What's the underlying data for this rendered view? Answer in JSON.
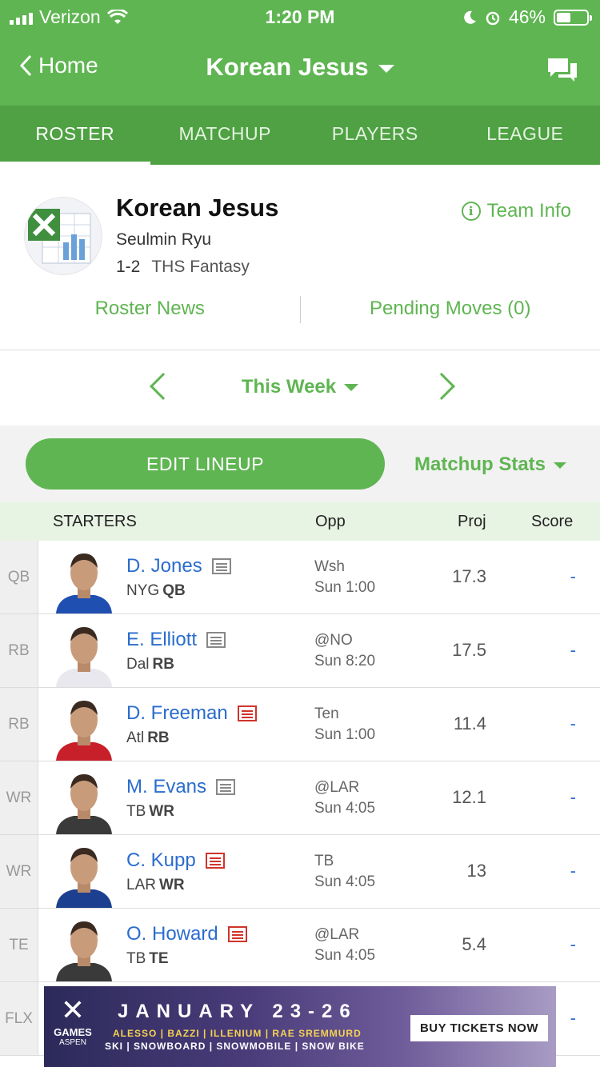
{
  "status": {
    "carrier": "Verizon",
    "time": "1:20 PM",
    "battery": "46%",
    "battery_level": 0.46
  },
  "header": {
    "back_label": "Home",
    "title": "Korean Jesus"
  },
  "tabs": [
    {
      "label": "ROSTER",
      "active": true
    },
    {
      "label": "MATCHUP",
      "active": false
    },
    {
      "label": "PLAYERS",
      "active": false
    },
    {
      "label": "LEAGUE",
      "active": false
    }
  ],
  "team": {
    "name": "Korean Jesus",
    "owner": "Seulmin Ryu",
    "record": "1-2",
    "league": "THS Fantasy",
    "info_label": "Team Info",
    "roster_news": "Roster News",
    "pending_moves": "Pending Moves (0)"
  },
  "week": {
    "label": "This Week"
  },
  "actions": {
    "edit_lineup": "EDIT LINEUP",
    "matchup_stats": "Matchup Stats"
  },
  "table": {
    "headers": {
      "starters": "STARTERS",
      "opp": "Opp",
      "proj": "Proj",
      "score": "Score"
    },
    "rows": [
      {
        "slot": "QB",
        "name": "D. Jones",
        "team": "NYG",
        "pos": "QB",
        "opp": "Wsh",
        "time": "Sun 1:00",
        "proj": "17.3",
        "score": "-",
        "news_red": false,
        "jersey": "#1f4fb0"
      },
      {
        "slot": "RB",
        "name": "E. Elliott",
        "team": "Dal",
        "pos": "RB",
        "opp": "@NO",
        "time": "Sun 8:20",
        "proj": "17.5",
        "score": "-",
        "news_red": false,
        "jersey": "#e8e8ee"
      },
      {
        "slot": "RB",
        "name": "D. Freeman",
        "team": "Atl",
        "pos": "RB",
        "opp": "Ten",
        "time": "Sun 1:00",
        "proj": "11.4",
        "score": "-",
        "news_red": true,
        "jersey": "#c8202a"
      },
      {
        "slot": "WR",
        "name": "M. Evans",
        "team": "TB",
        "pos": "WR",
        "opp": "@LAR",
        "time": "Sun 4:05",
        "proj": "12.1",
        "score": "-",
        "news_red": false,
        "jersey": "#3a3a3a"
      },
      {
        "slot": "WR",
        "name": "C. Kupp",
        "team": "LAR",
        "pos": "WR",
        "opp": "TB",
        "time": "Sun 4:05",
        "proj": "13",
        "score": "-",
        "news_red": true,
        "jersey": "#1d3f8f"
      },
      {
        "slot": "TE",
        "name": "O. Howard",
        "team": "TB",
        "pos": "TE",
        "opp": "@LAR",
        "time": "Sun 4:05",
        "proj": "5.4",
        "score": "-",
        "news_red": true,
        "jersey": "#3a3a3a"
      },
      {
        "slot": "FLX",
        "name": "",
        "team": "",
        "pos": "",
        "opp": "",
        "time": "",
        "proj": "",
        "score": "-",
        "news_red": false,
        "jersey": ""
      }
    ]
  },
  "ad": {
    "brand": "GAMES",
    "location": "ASPEN",
    "headline": "JANUARY 23-26",
    "artists": "ALESSO | BAZZI | ILLENIUM | RAE SREMMURD",
    "sports": "SKI | SNOWBOARD | SNOWMOBILE | SNOW BIKE",
    "cta": "BUY TICKETS NOW"
  },
  "colors": {
    "brand_green": "#5fb552",
    "tab_green": "#4fa144",
    "link_blue": "#2a6ccd",
    "news_red": "#d0342c"
  }
}
